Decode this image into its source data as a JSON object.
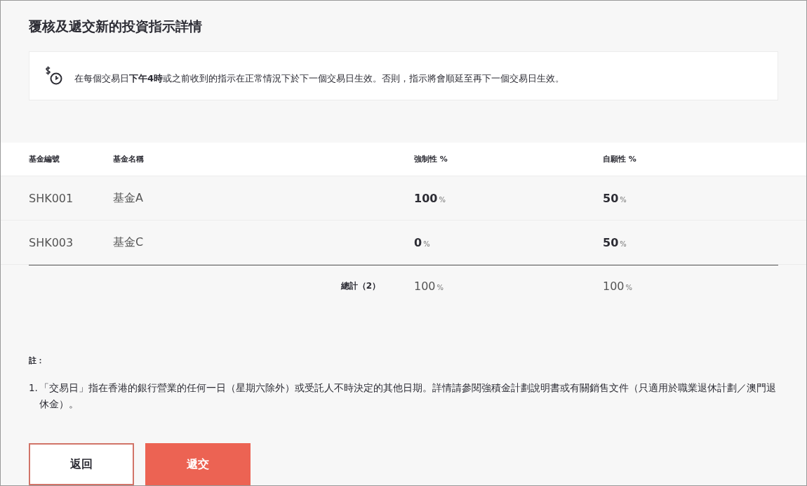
{
  "title": "覆核及遞交新的投資指示詳情",
  "info": {
    "text": "在每個交易日**下午4時**或之前收到的指示在正常情況下於下一個交易日生效。否則，指示將會順延至再下一個交易日生效。"
  },
  "table": {
    "columns": [
      "基金編號",
      "基金名稱",
      "強制性 %",
      "自願性 %"
    ],
    "rows": [
      {
        "code": "SHK001",
        "name": "基金A",
        "mandatory": {
          "value": "100",
          "unit": "%"
        },
        "voluntary": {
          "value": "50",
          "unit": "%"
        }
      },
      {
        "code": "SHK003",
        "name": "基金C",
        "mandatory": {
          "value": "0",
          "unit": "%"
        },
        "voluntary": {
          "value": "50",
          "unit": "%"
        }
      }
    ],
    "total": {
      "label": "總計（2）",
      "mandatory": {
        "value": "100",
        "unit": "%"
      },
      "voluntary": {
        "value": "100",
        "unit": "%"
      }
    }
  },
  "notes": {
    "heading": "註：",
    "items": [
      {
        "number": "1.",
        "text": "「交易日」指在香港的銀行營業的任何一日（星期六除外）或受託人不時決定的其他日期。詳情請參閱強積金計劃說明書或有關銷售文件（只適用於職業退休計劃／澳門退休金）。"
      }
    ]
  },
  "buttons": [
    {
      "label": "返回",
      "kind": "secondary"
    },
    {
      "label": "遞交",
      "kind": "primary"
    }
  ]
}
